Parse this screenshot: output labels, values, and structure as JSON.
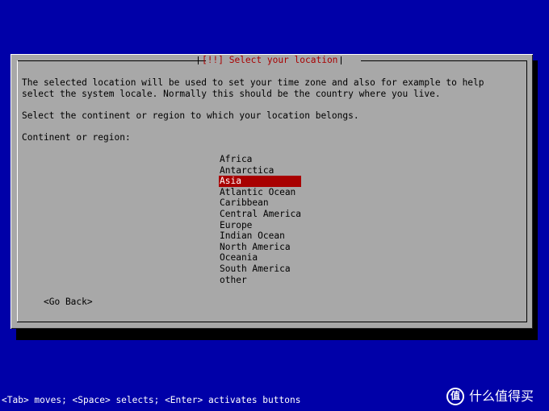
{
  "dialog": {
    "title_left_bracket": "[!!]",
    "title": "Select your location",
    "intro_lines": "The selected location will be used to set your time zone and also for example to help\nselect the system locale. Normally this should be the country where you live.",
    "prompt": "Select the continent or region to which your location belongs.",
    "field_label": "Continent or region:",
    "options": [
      "Africa",
      "Antarctica",
      "Asia",
      "Atlantic Ocean",
      "Caribbean",
      "Central America",
      "Europe",
      "Indian Ocean",
      "North America",
      "Oceania",
      "South America",
      "other"
    ],
    "selected_option": "Asia",
    "back_button": "<Go Back>"
  },
  "help_bar": "<Tab> moves; <Space> selects; <Enter> activates buttons",
  "watermark": {
    "text": "什么值得买",
    "logo_glyph": "值"
  },
  "colors": {
    "background": "#0000a8",
    "dialog": "#a8a8a8",
    "accent": "#a80000",
    "text": "#000000"
  }
}
